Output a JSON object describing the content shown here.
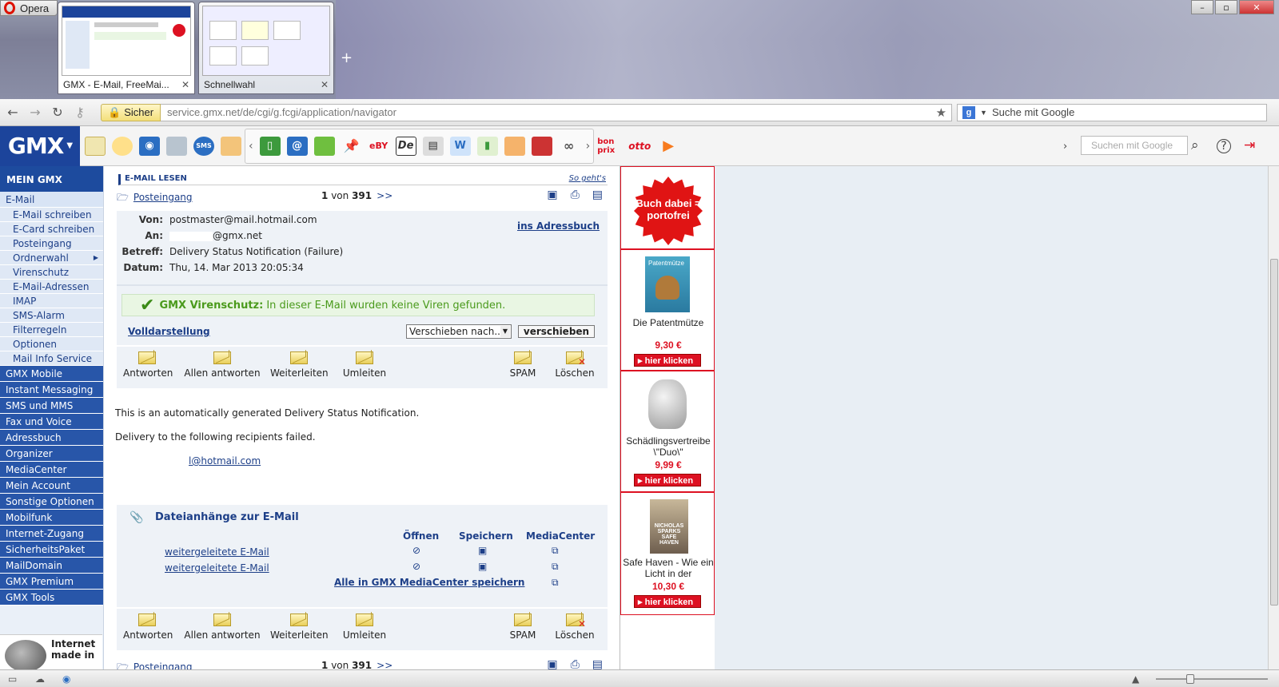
{
  "browser": {
    "menu_label": "Opera",
    "tabs": [
      {
        "label": "GMX - E-Mail, FreeMai..."
      },
      {
        "label": "Schnellwahl"
      }
    ],
    "security_label": "Sicher",
    "url": "service.gmx.net/de/cgi/g.fcgi/application/navigator",
    "search_placeholder": "Suche mit Google"
  },
  "gmx_toolbar": {
    "logo": "GMX",
    "search_placeholder": "Suchen mit Google"
  },
  "sidebar": {
    "header": "MEIN GMX",
    "email_label": "E-Mail",
    "email_subitems": [
      {
        "label": "E-Mail schreiben"
      },
      {
        "label": "E-Card schreiben"
      },
      {
        "label": "Posteingang"
      },
      {
        "label": "Ordnerwahl"
      },
      {
        "label": "Virenschutz"
      },
      {
        "label": "E-Mail-Adressen"
      },
      {
        "label": "IMAP"
      },
      {
        "label": "SMS-Alarm"
      },
      {
        "label": "Filterregeln"
      },
      {
        "label": "Optionen"
      },
      {
        "label": "Mail Info Service"
      }
    ],
    "main_items": [
      {
        "label": "GMX Mobile"
      },
      {
        "label": "Instant Messaging"
      },
      {
        "label": "SMS und MMS"
      },
      {
        "label": "Fax und Voice"
      },
      {
        "label": "Adressbuch"
      },
      {
        "label": "Organizer"
      },
      {
        "label": "MediaCenter"
      },
      {
        "label": "Mein Account"
      },
      {
        "label": "Sonstige Optionen"
      },
      {
        "label": "Mobilfunk"
      },
      {
        "label": "Internet-Zugang"
      },
      {
        "label": "SicherheitsPaket"
      },
      {
        "label": "MailDomain"
      },
      {
        "label": "GMX Premium"
      },
      {
        "label": "GMX Tools"
      }
    ],
    "bottom_ad": "Internet made in"
  },
  "mail": {
    "section_title": "E-MAIL LESEN",
    "howto_link": "So geht's",
    "folder": "Posteingang",
    "position": "1",
    "of_label": "von",
    "total": "391",
    "next": ">>",
    "from_key": "Von:",
    "from": "postmaster@mail.hotmail.com",
    "to_key": "An:",
    "to": "@gmx.net",
    "subject_key": "Betreff:",
    "subject": "Delivery Status Notification (Failure)",
    "date_key": "Datum:",
    "date": "Thu, 14. Mar 2013 20:05:34",
    "addressbook_link": "ins Adressbuch",
    "virus_title": "GMX Virenschutz:",
    "virus_text": "In dieser E-Mail wurden keine Viren gefunden.",
    "full_view_link": "Volldarstellung",
    "move_select": "Verschieben nach...",
    "move_button": "verschieben",
    "actions": {
      "reply": "Antworten",
      "reply_all": "Allen antworten",
      "forward": "Weiterleiten",
      "redirect": "Umleiten",
      "spam": "SPAM",
      "delete": "Löschen"
    },
    "body_line1": "This is an automatically generated Delivery Status Notification.",
    "body_line2": "Delivery to the following recipients failed.",
    "body_recipient": "l@hotmail.com",
    "attachments": {
      "title": "Dateianhänge zur E-Mail",
      "col_open": "Öffnen",
      "col_save": "Speichern",
      "col_mediacenter": "MediaCenter",
      "files": [
        {
          "name": "weitergeleitete E-Mail"
        },
        {
          "name": "weitergeleitete E-Mail"
        }
      ],
      "save_all": "Alle in GMX MediaCenter speichern"
    }
  },
  "ads": [
    {
      "badge": "Buch dabei = portofrei"
    },
    {
      "name": "Die Patentmütze",
      "price": "9,30 €",
      "cta": "hier klicken",
      "cover_text": "Patentmütze"
    },
    {
      "name": "Schädlingsvertreibe \\\"Duo\\\"",
      "price": "9,99 €",
      "cta": "hier klicken"
    },
    {
      "name": "Safe Haven - Wie ein Licht in der",
      "price": "10,30 €",
      "cta": "hier klicken",
      "cover_text": "NICHOLAS SPARKS SAFE HAVEN"
    }
  ]
}
